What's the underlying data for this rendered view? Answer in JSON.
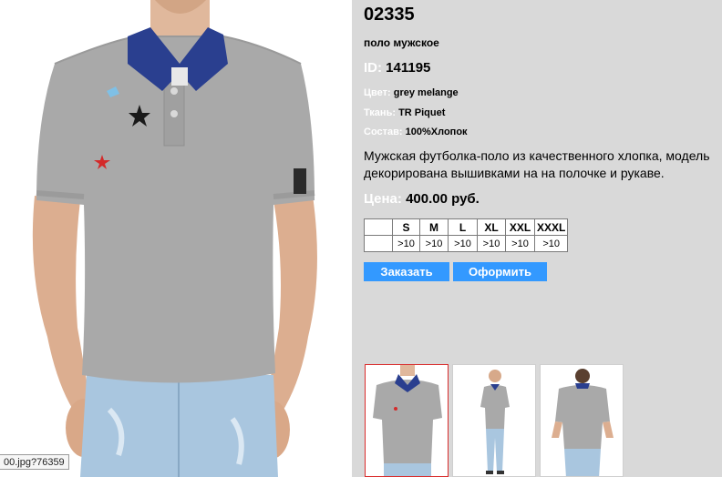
{
  "product": {
    "code": "02335",
    "type": "поло мужское",
    "id_label": "ID:",
    "id_value": "141195",
    "color_label": "Цвет:",
    "color_value": "grey melange",
    "fabric_label": "Ткань:",
    "fabric_value": "TR Piquet",
    "composition_label": "Состав:",
    "composition_value": "100%Хлопок",
    "description": "Мужская футболка-поло из качественного хлопка, модель декорирована вышивками на  на полочке и рукаве.",
    "price_label": "Цена:",
    "price_value": "400.00 руб."
  },
  "sizes": {
    "headers": [
      "",
      "S",
      "M",
      "L",
      "XL",
      "XXL",
      "XXXL"
    ],
    "stock": [
      "",
      ">10",
      ">10",
      ">10",
      ">10",
      ">10",
      ">10"
    ]
  },
  "buttons": {
    "order_label": "Заказать",
    "checkout_label": "Оформить"
  },
  "status_tip": "00.jpg?76359",
  "colors": {
    "panel_bg": "#d9d9d9",
    "accent": "#3399ff",
    "selected_thumb_border": "#d92b2b",
    "shirt": "#a9a9a9",
    "collar": "#2a3f8f",
    "jeans": "#a9c6df"
  }
}
